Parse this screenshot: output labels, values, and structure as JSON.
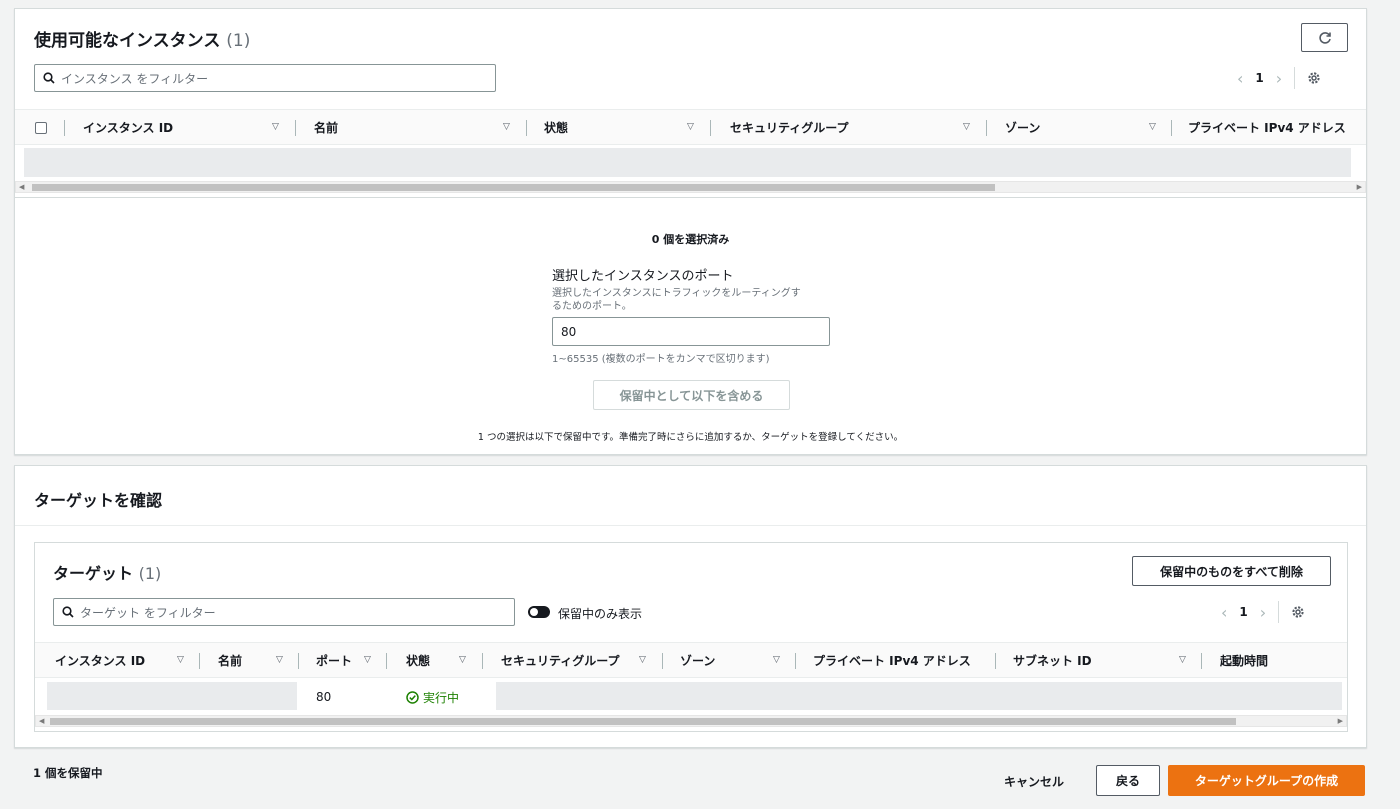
{
  "instances": {
    "title": "使用可能なインスタンス",
    "count": "(1)",
    "search_placeholder": "インスタンス をフィルター",
    "page": "1",
    "columns": [
      "インスタンス ID",
      "名前",
      "状態",
      "セキュリティグループ",
      "ゾーン",
      "プライベート IPv4 アドレス"
    ]
  },
  "selection": {
    "selected_count": "0 個を選択済み",
    "port_label": "選択したインスタンスのポート",
    "port_desc_1": "選択したインスタンスにトラフィックをルーティングす",
    "port_desc_2": "るためのポート。",
    "port_value": "80",
    "port_hint": "1~65535 (複数のポートをカンマで区切ります)",
    "include_button": "保留中として以下を含める",
    "pending_note": "1 つの選択は以下で保留中です。準備完了時にさらに追加するか、ターゲットを登録してください。"
  },
  "review": {
    "title": "ターゲットを確認",
    "targets_title": "ターゲット",
    "targets_count": "(1)",
    "remove_all_button": "保留中のものをすべて削除",
    "search_placeholder": "ターゲット をフィルター",
    "toggle_label": "保留中のみ表示",
    "page": "1",
    "columns": [
      "インスタンス ID",
      "名前",
      "ポート",
      "状態",
      "セキュリティグループ",
      "ゾーン",
      "プライベート IPv4 アドレス",
      "サブネット ID",
      "起動時間"
    ],
    "row": {
      "port": "80",
      "status": "実行中"
    }
  },
  "footer": {
    "pending": "1 個を保留中",
    "cancel": "キャンセル",
    "back": "戻る",
    "create": "ターゲットグループの作成"
  },
  "colors": {
    "primary": "#ec7211",
    "running": "#1d8102"
  }
}
